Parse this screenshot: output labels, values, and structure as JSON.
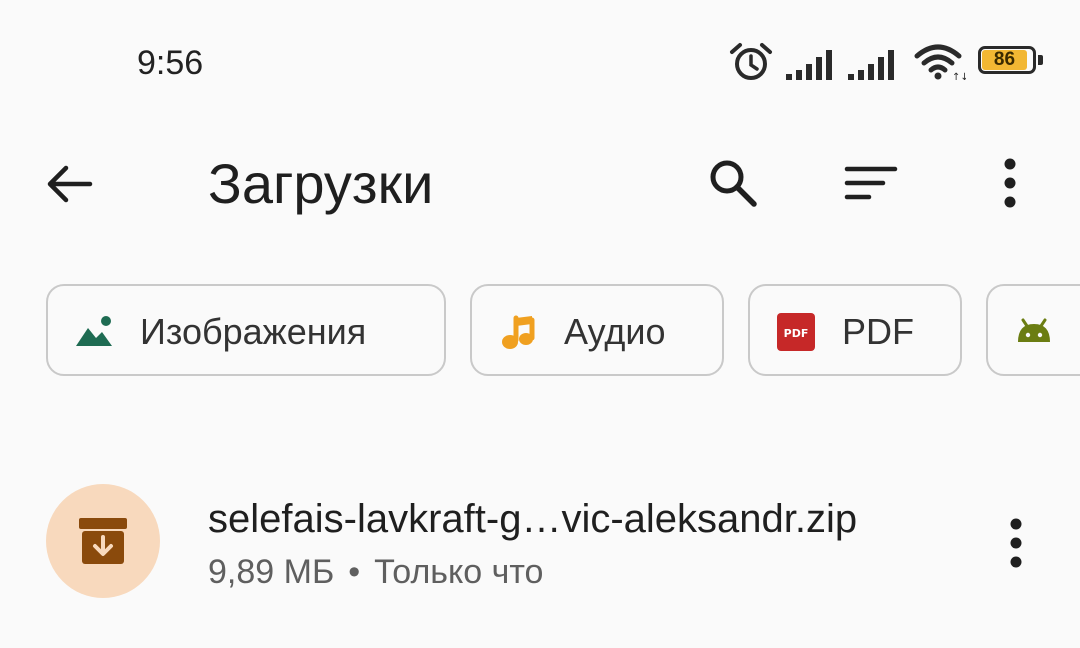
{
  "status_bar": {
    "time": "9:56",
    "battery_level": "86",
    "icons": [
      "alarm-icon",
      "signal-icon",
      "signal-icon",
      "wifi-icon",
      "battery-icon"
    ]
  },
  "app_bar": {
    "title": "Загрузки",
    "icons": [
      "back-arrow-icon",
      "search-icon",
      "sort-icon",
      "more-vert-icon"
    ]
  },
  "filter_chips": [
    {
      "label": "Изображения",
      "icon": "image-icon",
      "icon_color": "#1e6b52"
    },
    {
      "label": "Аудио",
      "icon": "music-note-icon",
      "icon_color": "#f0a020"
    },
    {
      "label": "PDF",
      "icon": "pdf-icon",
      "icon_color": "#c62828"
    },
    {
      "label": "",
      "icon": "android-icon",
      "icon_color": "#6b7d12"
    }
  ],
  "files": [
    {
      "name": "selefais-lavkraft-g…vic-aleksandr.zip",
      "size": "9,89 МБ",
      "separator": "•",
      "time": "Только что",
      "icon": "archive-icon",
      "icon_color": "#8a4a0c",
      "avatar_color": "#f8d9bd"
    }
  ]
}
